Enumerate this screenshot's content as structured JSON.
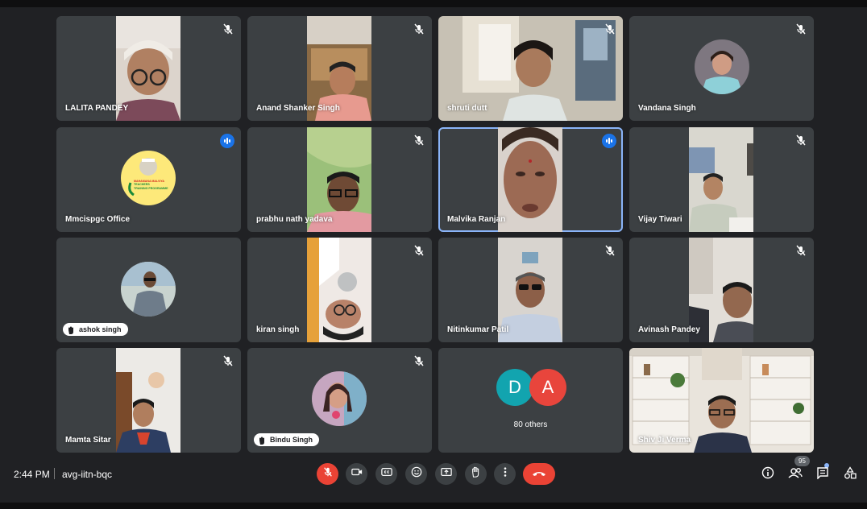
{
  "participants": [
    {
      "name": "LALITA PANDEY"
    },
    {
      "name": "Anand Shanker Singh"
    },
    {
      "name": "shruti dutt"
    },
    {
      "name": "Vandana Singh"
    },
    {
      "name": "Mmcispgc Office"
    },
    {
      "name": "prabhu nath yadava"
    },
    {
      "name": "Malvika Ranjan"
    },
    {
      "name": "Vijay Tiwari"
    },
    {
      "name": "ashok singh"
    },
    {
      "name": "kiran singh"
    },
    {
      "name": "Nitinkumar Patil"
    },
    {
      "name": "Avinash Pandey"
    },
    {
      "name": "Mamta Sitar"
    },
    {
      "name": "Bindu Singh"
    },
    {
      "name": "Shiv Ji Verma"
    }
  ],
  "others": {
    "initial_1": "D",
    "initial_2": "A",
    "label": "80 others",
    "color_1": "#12a4af",
    "color_2": "#e8453c"
  },
  "logo_text": {
    "line1": "MAHAMANA MALVIYA",
    "line2": "TEACHERS",
    "line3": "TRAINING PROGRAMME"
  },
  "footer": {
    "time": "2:44 PM",
    "meeting_code": "avg-iitn-bqc",
    "participant_count": "95"
  },
  "colors": {
    "background": "#202124",
    "tile": "#3c4043",
    "accent": "#8ab4f8",
    "danger": "#ea4335",
    "speaking": "#1a73e8"
  }
}
